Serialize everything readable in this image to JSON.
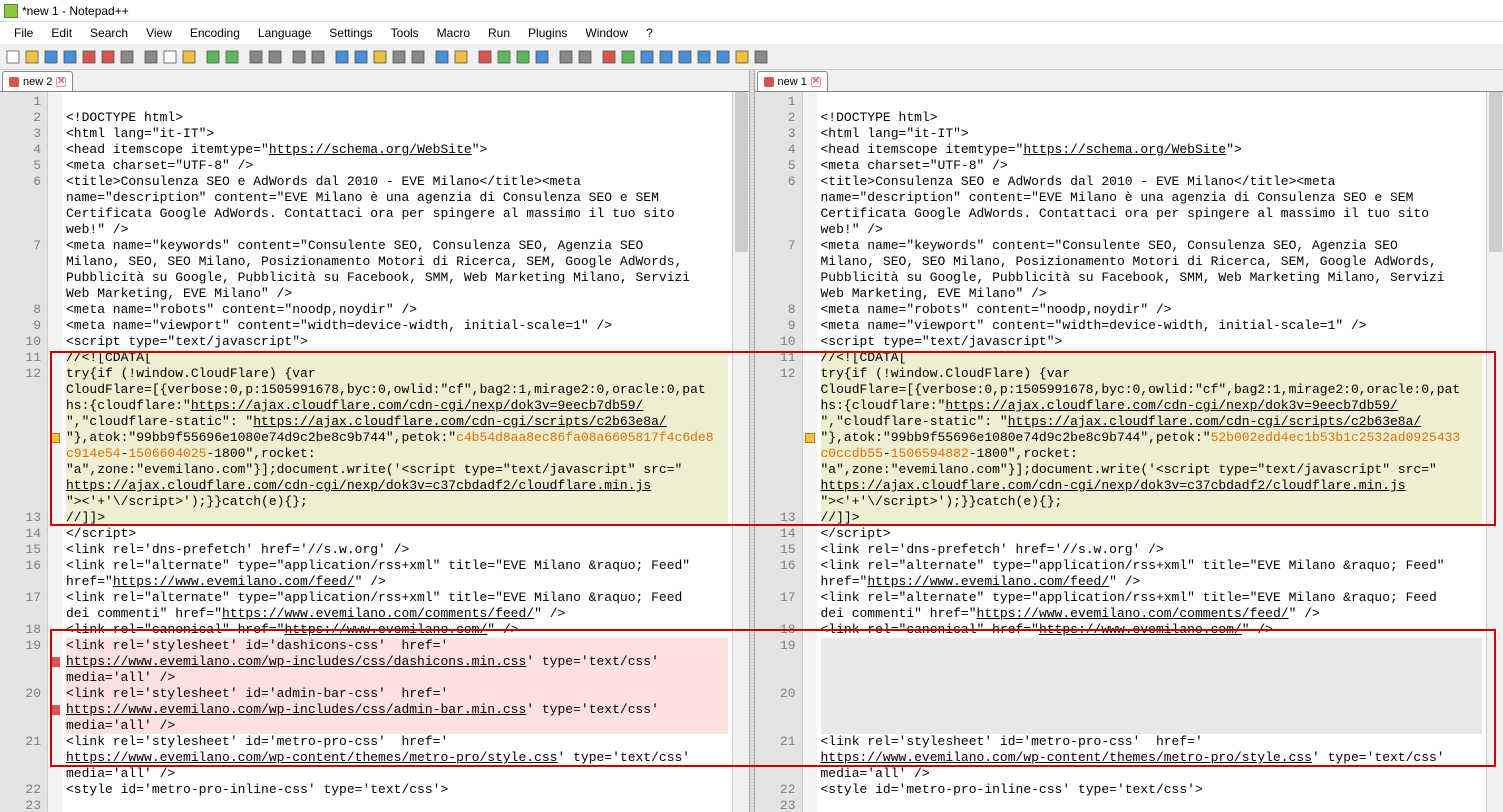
{
  "window": {
    "title": "*new 1 - Notepad++"
  },
  "menu": [
    "File",
    "Edit",
    "Search",
    "View",
    "Encoding",
    "Language",
    "Settings",
    "Tools",
    "Macro",
    "Run",
    "Plugins",
    "Window",
    "?"
  ],
  "tabsLeft": {
    "label": "new 2"
  },
  "tabsRight": {
    "label": "new 1"
  },
  "leftLines": [
    {
      "n": "1",
      "h": 1,
      "cls": "",
      "txt": ""
    },
    {
      "n": "2",
      "h": 1,
      "cls": "",
      "txt": "<!DOCTYPE html>"
    },
    {
      "n": "3",
      "h": 1,
      "cls": "",
      "txt": "<html lang=\"it-IT\">"
    },
    {
      "n": "4",
      "h": 1,
      "cls": "",
      "html": "&lt;head itemscope itemtype=\"<span class='u'>https://schema.org/WebSite</span>\"&gt;"
    },
    {
      "n": "5",
      "h": 1,
      "cls": "",
      "txt": "<meta charset=\"UTF-8\" />"
    },
    {
      "n": "6",
      "h": 4,
      "cls": "",
      "txt": "<title>Consulenza SEO e AdWords dal 2010 - EVE Milano</title><meta\nname=\"description\" content=\"EVE Milano è una agenzia di Consulenza SEO e SEM\nCertificata Google AdWords. Contattaci ora per spingere al massimo il tuo sito\nweb!\" />"
    },
    {
      "n": "7",
      "h": 4,
      "cls": "",
      "txt": "<meta name=\"keywords\" content=\"Consulente SEO, Consulenza SEO, Agenzia SEO\nMilano, SEO, SEO Milano, Posizionamento Motori di Ricerca, SEM, Google AdWords,\nPubblicità su Google, Pubblicità su Facebook, SMM, Web Marketing Milano, Servizi\nWeb Marketing, EVE Milano\" />"
    },
    {
      "n": "8",
      "h": 1,
      "cls": "",
      "txt": "<meta name=\"robots\" content=\"noodp,noydir\" />"
    },
    {
      "n": "9",
      "h": 1,
      "cls": "",
      "txt": "<meta name=\"viewport\" content=\"width=device-width, initial-scale=1\" />"
    },
    {
      "n": "10",
      "h": 1,
      "cls": "",
      "txt": "<script type=\"text/javascript\">"
    },
    {
      "n": "11",
      "h": 1,
      "cls": "diff-yellow",
      "txt": "//<![CDATA["
    },
    {
      "n": "12",
      "h": 9,
      "cls": "diff-yellow",
      "mk": "cf",
      "html": "try{if (!window.CloudFlare) {var\nCloudFlare=[{verbose:0,p:1505991678,byc:0,owlid:\"cf\",bag2:1,mirage2:0,oracle:0,pat\nhs:{cloudflare:\"<span class='u'>https://ajax.cloudflare.com/cdn-cgi/nexp/dok3v=9eecb7db59/</span>\n\",\"cloudflare-static\": \"<span class='u'>https://ajax.cloudflare.com/cdn-cgi/scripts/c2b63e8a/</span>\n\"},atok:\"99bb9f55696e1080e74d9c2be8c9b744\",petok:\"<span class='hl-orange'>c4b54d8aa8ec86fa08a6605817f4c6de8</span>\n<span class='hl-orange'>c914e54</span>-<span class='hl-orange'>1506604025</span>-1800\",rocket:\n\"a\",zone:\"evemilano.com\"}];document.write('&lt;script type=\"text/javascript\" src=\"\n<span class='u'>https://ajax.cloudflare.com/cdn-cgi/nexp/dok3v=c37cbdadf2/cloudflare.min.js</span>\n\"&gt;&lt;'+'\\/script&gt;');}}catch(e){};"
    },
    {
      "n": "13",
      "h": 1,
      "cls": "diff-yellow",
      "txt": "//]]>"
    },
    {
      "n": "14",
      "h": 1,
      "cls": "",
      "txt": "</script>"
    },
    {
      "n": "15",
      "h": 1,
      "cls": "",
      "txt": "<link rel='dns-prefetch' href='//s.w.org' />"
    },
    {
      "n": "16",
      "h": 2,
      "cls": "",
      "html": "&lt;link rel=\"alternate\" type=\"application/rss+xml\" title=\"EVE Milano &amp;raquo; Feed\"\nhref=\"<span class='u'>https://www.evemilano.com/feed/</span>\" /&gt;"
    },
    {
      "n": "17",
      "h": 2,
      "cls": "",
      "html": "&lt;link rel=\"alternate\" type=\"application/rss+xml\" title=\"EVE Milano &amp;raquo; Feed\ndei commenti\" href=\"<span class='u'>https://www.evemilano.com/comments/feed/</span>\" /&gt;"
    },
    {
      "n": "18",
      "h": 1,
      "cls": "",
      "html": "&lt;link rel=\"canonical\" href=\"<span class='u'>https://www.evemilano.com/</span>\" /&gt;"
    },
    {
      "n": "19",
      "h": 3,
      "cls": "diff-red",
      "mk": "del",
      "html": "&lt;link rel='stylesheet' id='dashicons-css'  href='\n<span class='u'>https://www.evemilano.com/wp-includes/css/dashicons.min.css</span>' type='text/css'\nmedia='all' /&gt;"
    },
    {
      "n": "20",
      "h": 3,
      "cls": "diff-red",
      "mk": "del",
      "html": "&lt;link rel='stylesheet' id='admin-bar-css'  href='\n<span class='u'>https://www.evemilano.com/wp-includes/css/admin-bar.min.css</span>' type='text/css'\nmedia='all' /&gt;"
    },
    {
      "n": "21",
      "h": 3,
      "cls": "",
      "html": "&lt;link rel='stylesheet' id='metro-pro-css'  href='\n<span class='u'>https://www.evemilano.com/wp-content/themes/metro-pro/style.css</span>' type='text/css'\nmedia='all' /&gt;"
    },
    {
      "n": "22",
      "h": 1,
      "cls": "",
      "txt": "<style id='metro-pro-inline-css' type='text/css'>"
    },
    {
      "n": "23",
      "h": 1,
      "cls": "",
      "txt": ""
    }
  ],
  "rightLines": [
    {
      "n": "1",
      "h": 1,
      "cls": "",
      "txt": ""
    },
    {
      "n": "2",
      "h": 1,
      "cls": "",
      "txt": "<!DOCTYPE html>"
    },
    {
      "n": "3",
      "h": 1,
      "cls": "",
      "txt": "<html lang=\"it-IT\">"
    },
    {
      "n": "4",
      "h": 1,
      "cls": "",
      "html": "&lt;head itemscope itemtype=\"<span class='u'>https://schema.org/WebSite</span>\"&gt;"
    },
    {
      "n": "5",
      "h": 1,
      "cls": "",
      "txt": "<meta charset=\"UTF-8\" />"
    },
    {
      "n": "6",
      "h": 4,
      "cls": "",
      "txt": "<title>Consulenza SEO e AdWords dal 2010 - EVE Milano</title><meta\nname=\"description\" content=\"EVE Milano è una agenzia di Consulenza SEO e SEM\nCertificata Google AdWords. Contattaci ora per spingere al massimo il tuo sito\nweb!\" />"
    },
    {
      "n": "7",
      "h": 4,
      "cls": "",
      "txt": "<meta name=\"keywords\" content=\"Consulente SEO, Consulenza SEO, Agenzia SEO\nMilano, SEO, SEO Milano, Posizionamento Motori di Ricerca, SEM, Google AdWords,\nPubblicità su Google, Pubblicità su Facebook, SMM, Web Marketing Milano, Servizi\nWeb Marketing, EVE Milano\" />"
    },
    {
      "n": "8",
      "h": 1,
      "cls": "",
      "txt": "<meta name=\"robots\" content=\"noodp,noydir\" />"
    },
    {
      "n": "9",
      "h": 1,
      "cls": "",
      "txt": "<meta name=\"viewport\" content=\"width=device-width, initial-scale=1\" />"
    },
    {
      "n": "10",
      "h": 1,
      "cls": "",
      "txt": "<script type=\"text/javascript\">"
    },
    {
      "n": "11",
      "h": 1,
      "cls": "diff-yellow",
      "txt": "//<![CDATA["
    },
    {
      "n": "12",
      "h": 9,
      "cls": "diff-yellow",
      "mk": "cf",
      "html": "try{if (!window.CloudFlare) {var\nCloudFlare=[{verbose:0,p:1505991678,byc:0,owlid:\"cf\",bag2:1,mirage2:0,oracle:0,pat\nhs:{cloudflare:\"<span class='u'>https://ajax.cloudflare.com/cdn-cgi/nexp/dok3v=9eecb7db59/</span>\n\",\"cloudflare-static\": \"<span class='u'>https://ajax.cloudflare.com/cdn-cgi/scripts/c2b63e8a/</span>\n\"},atok:\"99bb9f55696e1080e74d9c2be8c9b744\",petok:\"<span class='hl-orange'>52b002edd4ec1b53b1c2532ad0925433</span>\n<span class='hl-orange'>c0ccdb55</span>-<span class='hl-orange'>1506594882</span>-1800\",rocket:\n\"a\",zone:\"evemilano.com\"}];document.write('&lt;script type=\"text/javascript\" src=\"\n<span class='u'>https://ajax.cloudflare.com/cdn-cgi/nexp/dok3v=c37cbdadf2/cloudflare.min.js</span>\n\"&gt;&lt;'+'\\/script&gt;');}}catch(e){};"
    },
    {
      "n": "13",
      "h": 1,
      "cls": "diff-yellow",
      "txt": "//]]>"
    },
    {
      "n": "14",
      "h": 1,
      "cls": "",
      "txt": "</script>"
    },
    {
      "n": "15",
      "h": 1,
      "cls": "",
      "txt": "<link rel='dns-prefetch' href='//s.w.org' />"
    },
    {
      "n": "16",
      "h": 2,
      "cls": "",
      "html": "&lt;link rel=\"alternate\" type=\"application/rss+xml\" title=\"EVE Milano &amp;raquo; Feed\"\nhref=\"<span class='u'>https://www.evemilano.com/feed/</span>\" /&gt;"
    },
    {
      "n": "17",
      "h": 2,
      "cls": "",
      "html": "&lt;link rel=\"alternate\" type=\"application/rss+xml\" title=\"EVE Milano &amp;raquo; Feed\ndei commenti\" href=\"<span class='u'>https://www.evemilano.com/comments/feed/</span>\" /&gt;"
    },
    {
      "n": "18",
      "h": 1,
      "cls": "",
      "html": "&lt;link rel=\"canonical\" href=\"<span class='u'>https://www.evemilano.com/</span>\" /&gt;"
    },
    {
      "n": "19",
      "h": 3,
      "cls": "diff-gray",
      "txt": "\n\n"
    },
    {
      "n": "20",
      "h": 3,
      "cls": "diff-gray",
      "txt": "\n\n"
    },
    {
      "n": "21",
      "h": 3,
      "cls": "",
      "html": "&lt;link rel='stylesheet' id='metro-pro-css'  href='\n<span class='u'>https://www.evemilano.com/wp-content/themes/metro-pro/style.css</span>' type='text/css'\nmedia='all' /&gt;"
    },
    {
      "n": "22",
      "h": 1,
      "cls": "",
      "txt": "<style id='metro-pro-inline-css' type='text/css'>"
    },
    {
      "n": "23",
      "h": 1,
      "cls": "",
      "txt": ""
    }
  ],
  "toolbarIcons": [
    "new-file",
    "open-file",
    "save",
    "save-all",
    "close",
    "close-all",
    "print",
    "sep",
    "cut",
    "copy",
    "paste",
    "sep",
    "undo",
    "redo",
    "sep",
    "find",
    "replace",
    "sep",
    "zoom-in",
    "zoom-out",
    "sep",
    "sync-v",
    "sync-h",
    "word-wrap",
    "show-all",
    "indent-guide",
    "sep",
    "lang",
    "folder",
    "sep",
    "macro-rec",
    "macro-play",
    "macro-play-multi",
    "macro-save",
    "sep",
    "nav-prev",
    "nav-next",
    "sep",
    "compare-1",
    "compare-2",
    "compare-move",
    "compare-nav",
    "compare-first",
    "compare-prev",
    "compare-next",
    "compare-last",
    "compare-opt"
  ]
}
